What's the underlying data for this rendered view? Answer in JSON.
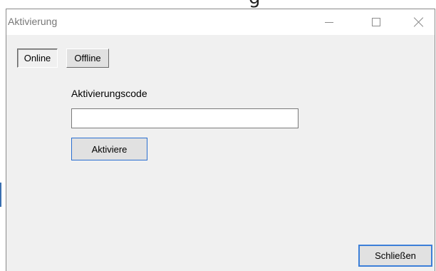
{
  "window": {
    "title": "Aktivierung",
    "controls": {
      "minimize_icon": "minimize-icon",
      "maximize_icon": "maximize-icon",
      "close_icon": "close-icon"
    }
  },
  "tabs": [
    {
      "label": "Online",
      "selected": true
    },
    {
      "label": "Offline",
      "selected": false
    }
  ],
  "form": {
    "code_label": "Aktivierungscode",
    "code_value": "",
    "activate_label": "Aktiviere"
  },
  "footer": {
    "close_label": "Schließen"
  },
  "colors": {
    "window_bg": "#f0f0f0",
    "titlebar_bg": "#ffffff",
    "focus_border": "#3c7fd8"
  }
}
